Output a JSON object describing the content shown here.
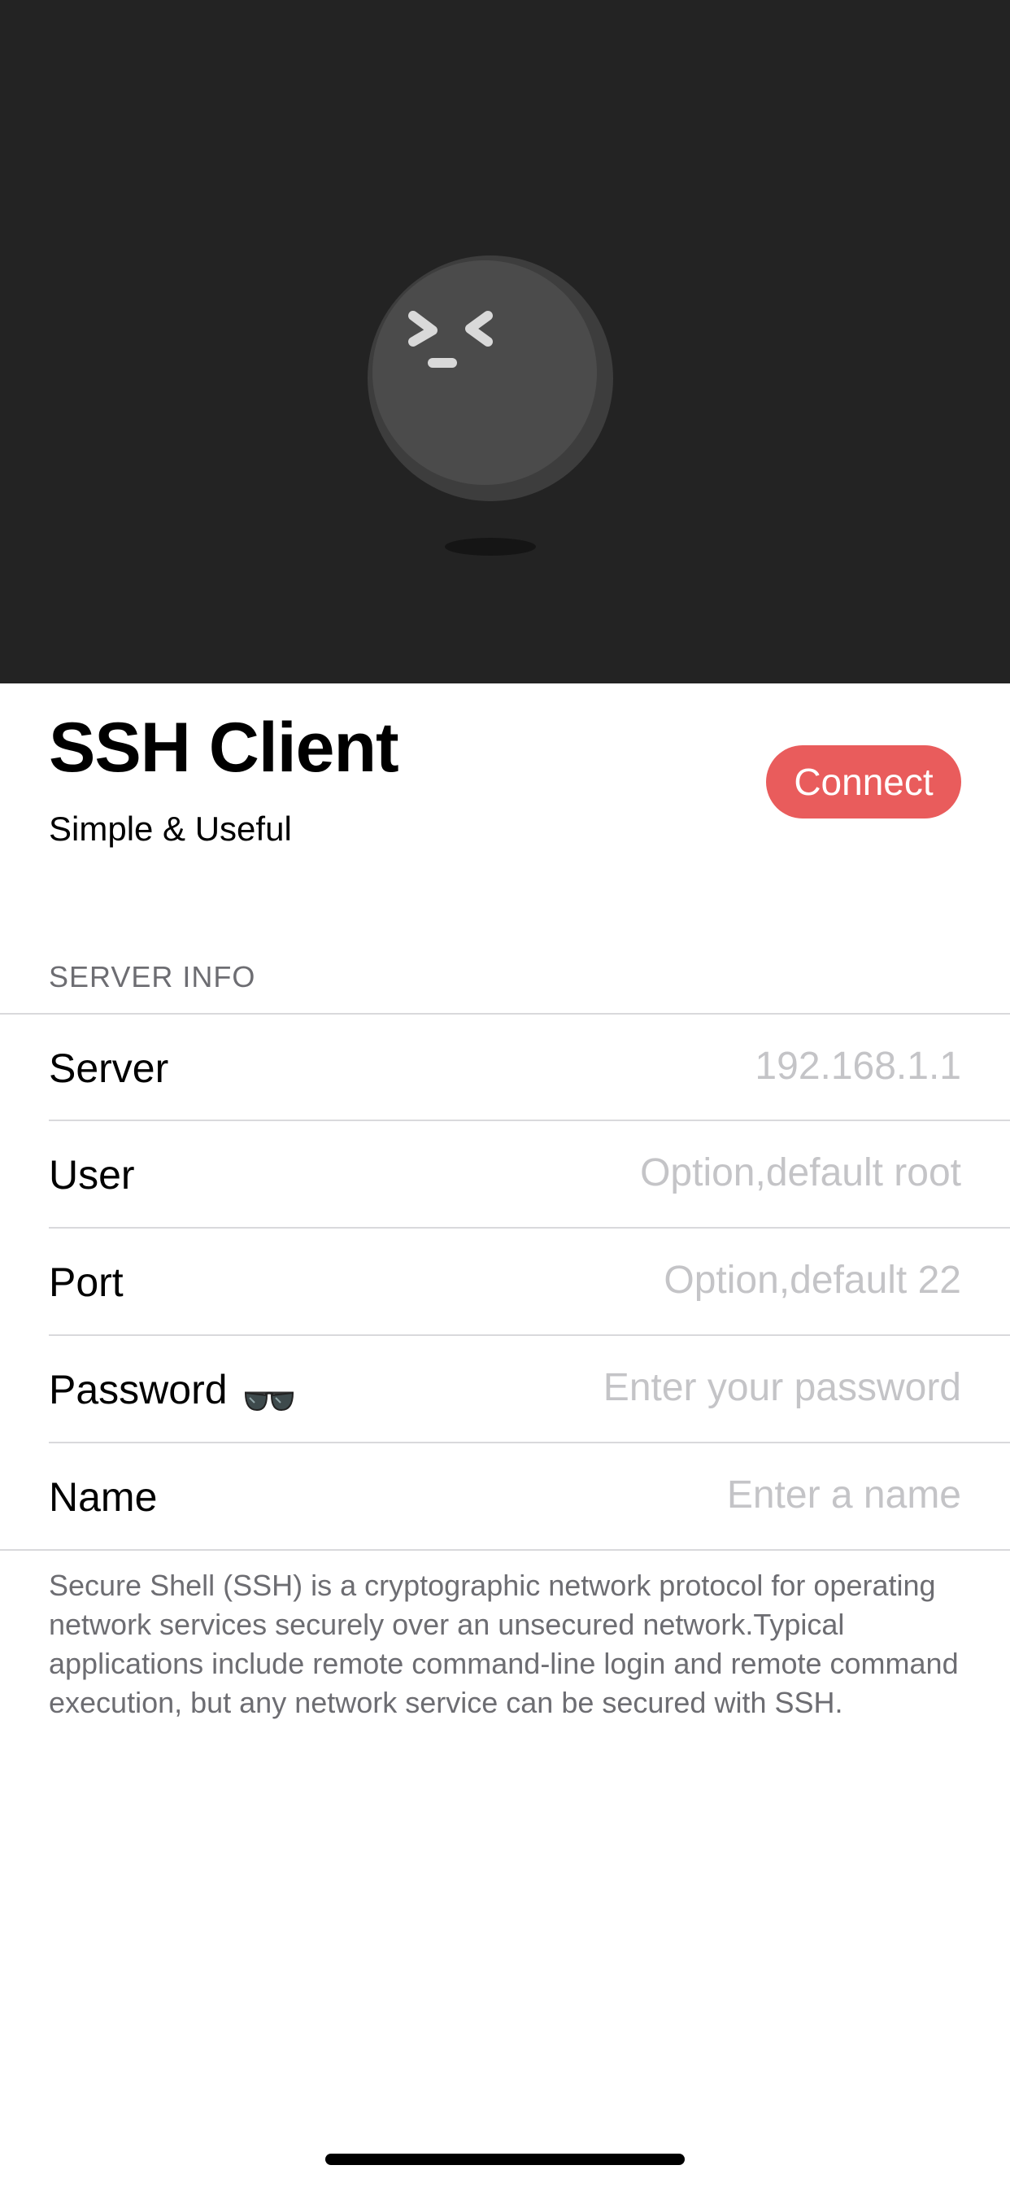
{
  "app": {
    "title": "SSH Client",
    "subtitle": "Simple & Useful",
    "connect_label": "Connect"
  },
  "form": {
    "section_header": "SERVER INFO",
    "fields": [
      {
        "label": "Server",
        "placeholder": "192.168.1.1",
        "value": ""
      },
      {
        "label": "User",
        "placeholder": "Option,default root",
        "value": ""
      },
      {
        "label": "Port",
        "placeholder": "Option,default 22",
        "value": ""
      },
      {
        "label": "Password",
        "placeholder": "Enter your password",
        "value": ""
      },
      {
        "label": "Name",
        "placeholder": "Enter a name",
        "value": ""
      }
    ],
    "footer": "Secure Shell (SSH) is a cryptographic network protocol for operating network services securely over an unsecured network.Typical applications include remote command-line login and remote command execution, but any network service can be secured with SSH."
  },
  "icons": {
    "mascot": "mascot-ball-icon",
    "password_toggle": "glasses-icon"
  },
  "colors": {
    "hero_background": "#232323",
    "accent": "#e95c5c",
    "placeholder": "#c4c4c7",
    "secondary_text": "#6d6d72"
  }
}
